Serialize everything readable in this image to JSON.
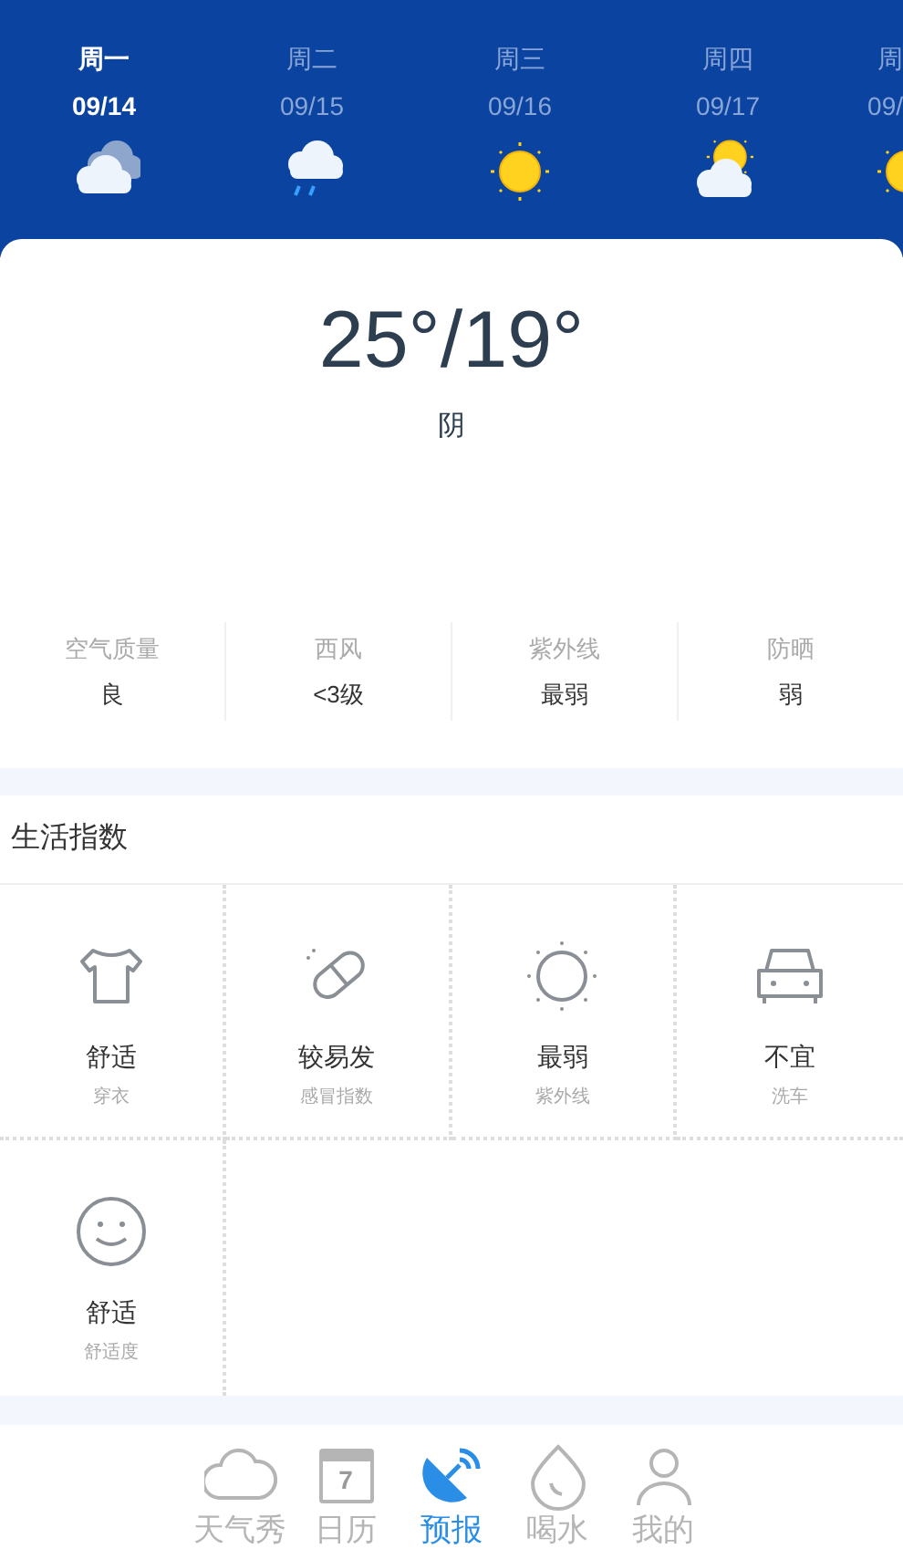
{
  "days": [
    {
      "weekday": "周一",
      "date": "09/14",
      "kind": "cloudy",
      "selected": true
    },
    {
      "weekday": "周二",
      "date": "09/15",
      "kind": "rain",
      "selected": false
    },
    {
      "weekday": "周三",
      "date": "09/16",
      "kind": "sunny",
      "selected": false
    },
    {
      "weekday": "周四",
      "date": "09/17",
      "kind": "partly",
      "selected": false
    },
    {
      "weekday": "周",
      "date": "09/",
      "kind": "sunny",
      "selected": false
    }
  ],
  "current": {
    "temperature": "25°/19°",
    "condition": "阴"
  },
  "stats": [
    {
      "label": "空气质量",
      "value": "良"
    },
    {
      "label": "西风",
      "value": "<3级"
    },
    {
      "label": "紫外线",
      "value": "最弱"
    },
    {
      "label": "防晒",
      "value": "弱"
    }
  ],
  "life_index": {
    "title": "生活指数",
    "items": [
      {
        "kind": "shirt",
        "value": "舒适",
        "label": "穿衣"
      },
      {
        "kind": "pill",
        "value": "较易发",
        "label": "感冒指数"
      },
      {
        "kind": "sun",
        "value": "最弱",
        "label": "紫外线"
      },
      {
        "kind": "car",
        "value": "不宜",
        "label": "洗车"
      },
      {
        "kind": "smile",
        "value": "舒适",
        "label": "舒适度"
      }
    ]
  },
  "nav": [
    {
      "kind": "cloud",
      "label": "天气秀",
      "selected": false
    },
    {
      "kind": "calendar",
      "label": "日历",
      "icon_text": "7",
      "selected": false
    },
    {
      "kind": "dish",
      "label": "预报",
      "selected": true
    },
    {
      "kind": "drop",
      "label": "喝水",
      "selected": false
    },
    {
      "kind": "person",
      "label": "我的",
      "selected": false
    }
  ]
}
